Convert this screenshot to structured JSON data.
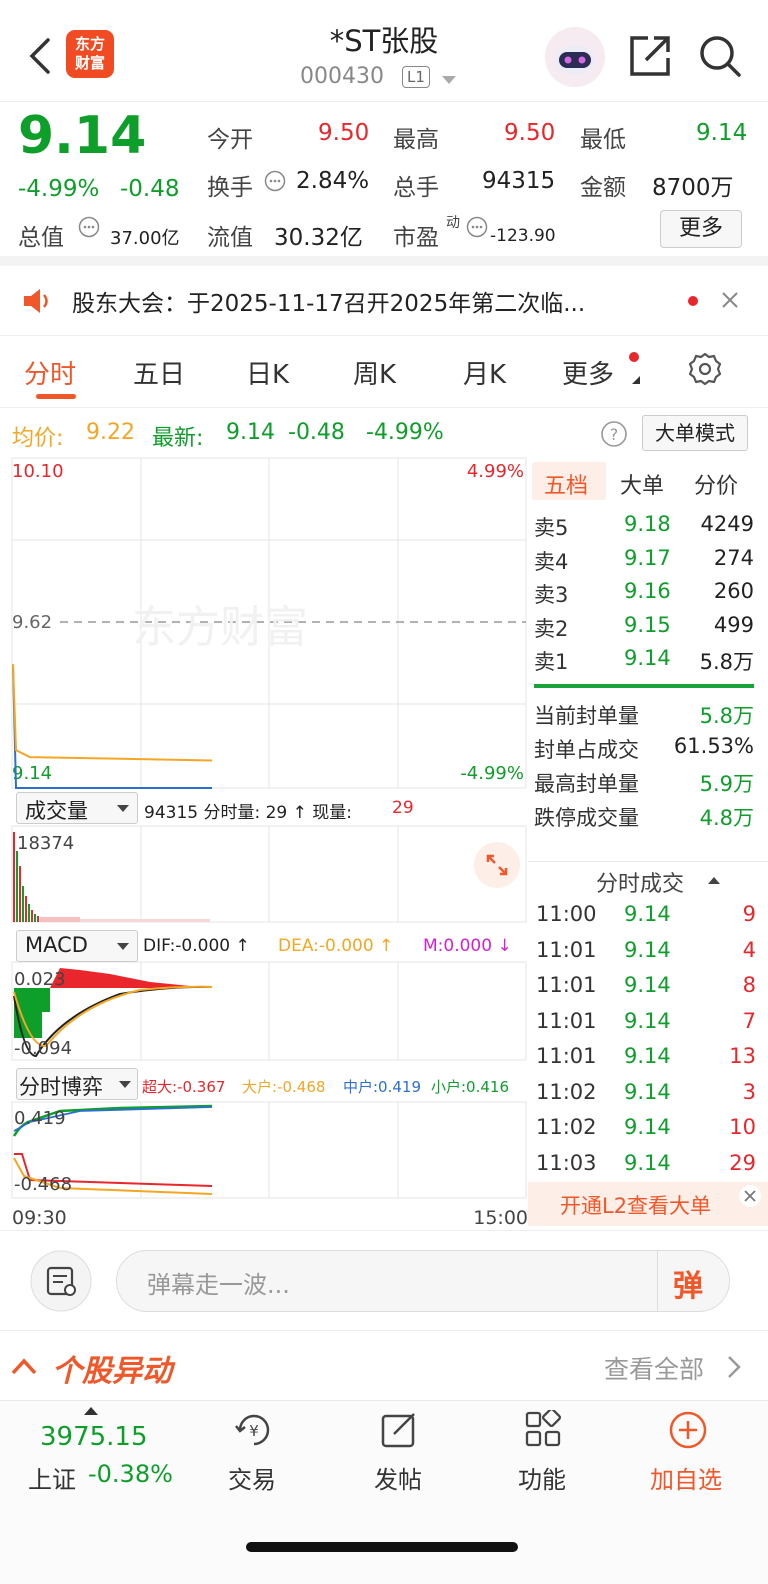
{
  "header": {
    "logo_text_1": "东方",
    "logo_text_2": "财富",
    "title": "*ST张股",
    "code": "000430",
    "level": "L1"
  },
  "quote": {
    "price": "9.14",
    "change_pct": "-4.99%",
    "change": "-0.48",
    "open_label": "今开",
    "open": "9.50",
    "high_label": "最高",
    "high": "9.50",
    "low_label": "最低",
    "low": "9.14",
    "turnover_label": "换手",
    "turnover": "2.84%",
    "volume_label": "总手",
    "volume": "94315",
    "amount_label": "金额",
    "amount": "8700万",
    "mktcap_label": "总值",
    "mktcap": "37.00亿",
    "float_label": "流值",
    "float": "30.32亿",
    "pe_label": "市盈",
    "pe_sup": "动",
    "pe": "-123.90",
    "more": "更多"
  },
  "notice": {
    "text": "股东大会：于2025-11-17召开2025年第二次临..."
  },
  "tabs": [
    "分时",
    "五日",
    "日K",
    "周K",
    "月K",
    "更多"
  ],
  "infobar": {
    "avg_label": "均价:",
    "avg": "9.22",
    "latest_label": "最新:",
    "latest": "9.14",
    "latest_chg": "-0.48",
    "latest_pct": "-4.99%",
    "mode_btn": "大单模式"
  },
  "chart": {
    "top_price": "10.10",
    "top_pct": "4.99%",
    "mid_price": "9.62",
    "bottom_price": "9.14",
    "bottom_pct": "-4.99%",
    "watermark": "东方财富",
    "vol_select": "成交量",
    "vol_text_1": "94315 分时量: 29 ↑ 现量:",
    "vol_now": "29",
    "vol_max": "18374",
    "macd_select": "MACD",
    "dif": "DIF:-0.000 ↑",
    "dea": "DEA:-0.000 ↑",
    "m": "M:0.000 ↓",
    "macd_top": "0.023",
    "macd_bottom": "-0.094",
    "game_select": "分时博弈",
    "chaoda": "超大:-0.367",
    "dahu": "大户:-0.468",
    "zhonghu": "中户:0.419",
    "xiaohu": "小户:0.416",
    "game_top": "0.419",
    "game_bottom": "-0.468",
    "time_start": "09:30",
    "time_end": "15:00"
  },
  "chart_data": {
    "type": "line",
    "title": "",
    "x": [
      "09:30",
      "15:00"
    ],
    "series": [
      {
        "name": "price",
        "values": [
          9.5,
          9.14,
          9.14,
          9.14
        ]
      },
      {
        "name": "avg",
        "values": [
          9.5,
          9.25,
          9.23,
          9.22
        ]
      }
    ],
    "ylim": [
      9.14,
      10.1
    ]
  },
  "orderbook": {
    "tabs": [
      "五档",
      "大单",
      "分价"
    ],
    "asks": [
      {
        "label": "卖5",
        "price": "9.18",
        "vol": "4249"
      },
      {
        "label": "卖4",
        "price": "9.17",
        "vol": "274"
      },
      {
        "label": "卖3",
        "price": "9.16",
        "vol": "260"
      },
      {
        "label": "卖2",
        "price": "9.15",
        "vol": "499"
      },
      {
        "label": "卖1",
        "price": "9.14",
        "vol": "5.8万"
      }
    ],
    "stats": [
      {
        "label": "当前封单量",
        "value": "5.8万"
      },
      {
        "label": "封单占成交",
        "value": "61.53%"
      },
      {
        "label": "最高封单量",
        "value": "5.9万"
      },
      {
        "label": "跌停成交量",
        "value": "4.8万"
      }
    ],
    "ticks_title": "分时成交",
    "ticks": [
      {
        "t": "11:00",
        "p": "9.14",
        "v": "9"
      },
      {
        "t": "11:01",
        "p": "9.14",
        "v": "4"
      },
      {
        "t": "11:01",
        "p": "9.14",
        "v": "8"
      },
      {
        "t": "11:01",
        "p": "9.14",
        "v": "7"
      },
      {
        "t": "11:01",
        "p": "9.14",
        "v": "13"
      },
      {
        "t": "11:02",
        "p": "9.14",
        "v": "3"
      },
      {
        "t": "11:02",
        "p": "9.14",
        "v": "10"
      },
      {
        "t": "11:03",
        "p": "9.14",
        "v": "29"
      }
    ],
    "l2_text": "开通L2查看大单"
  },
  "comment": {
    "placeholder": "弹幕走一波...",
    "send": "弹"
  },
  "movement": {
    "title": "个股异动",
    "view_all": "查看全部"
  },
  "bottom": {
    "index_value": "3975.15",
    "index_name": "上证",
    "index_pct": "-0.38%",
    "trade": "交易",
    "post": "发帖",
    "func": "功能",
    "add": "加自选"
  }
}
